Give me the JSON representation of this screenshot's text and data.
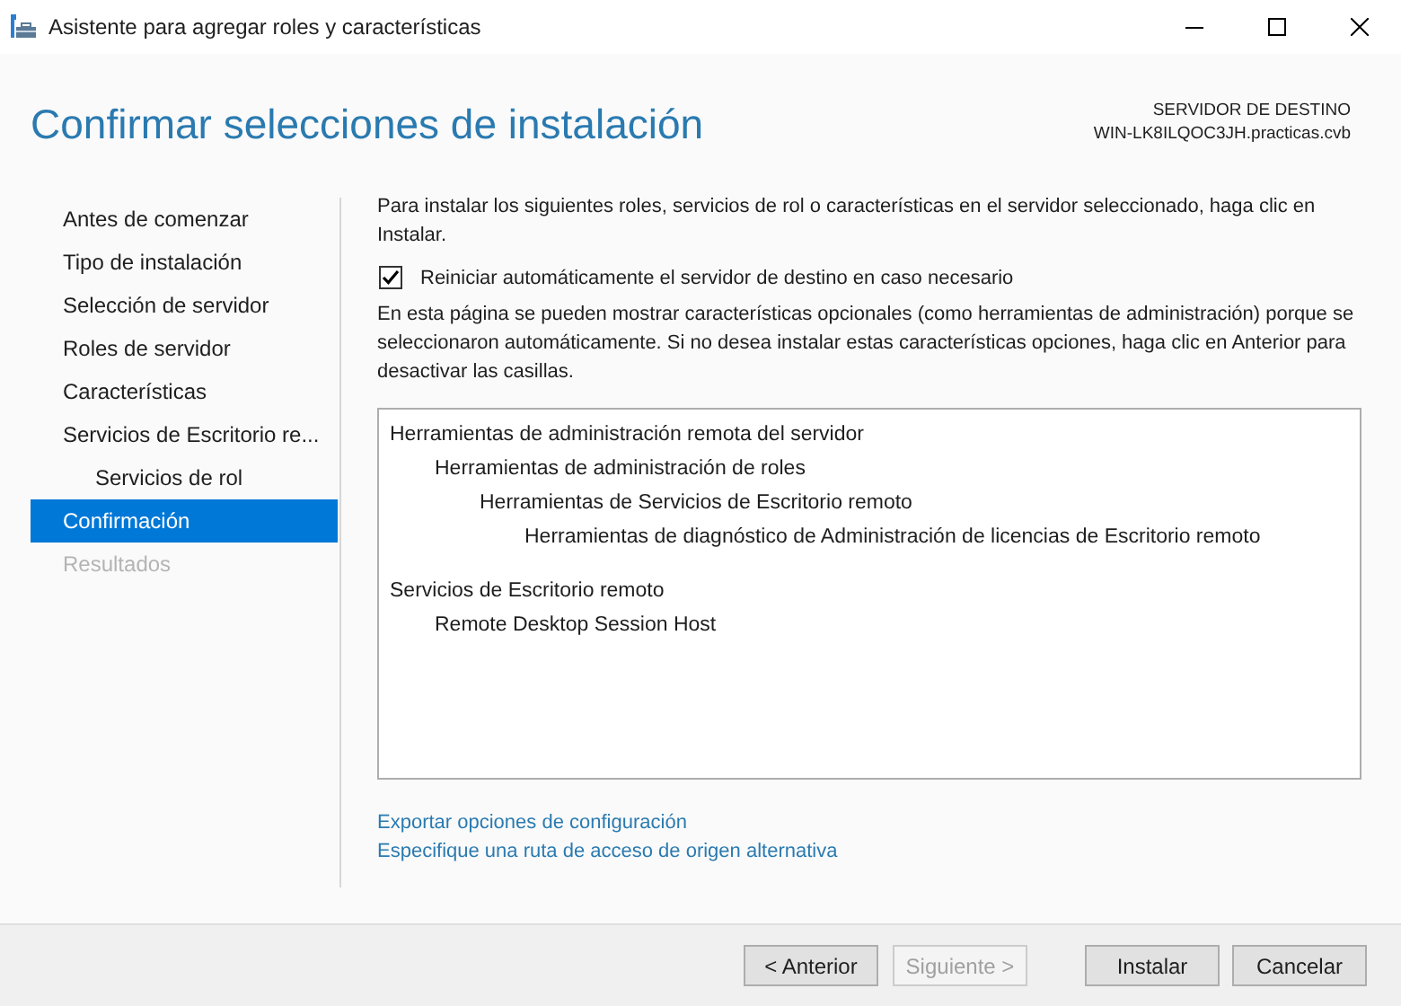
{
  "window": {
    "title": "Asistente para agregar roles y características"
  },
  "page_title": "Confirmar selecciones de instalación",
  "destination": {
    "label": "SERVIDOR DE DESTINO",
    "server": "WIN-LK8ILQOC3JH.practicas.cvb"
  },
  "sidebar": {
    "items": [
      {
        "label": "Antes de comenzar",
        "selected": false,
        "disabled": false
      },
      {
        "label": "Tipo de instalación",
        "selected": false,
        "disabled": false
      },
      {
        "label": "Selección de servidor",
        "selected": false,
        "disabled": false
      },
      {
        "label": "Roles de servidor",
        "selected": false,
        "disabled": false
      },
      {
        "label": "Características",
        "selected": false,
        "disabled": false
      },
      {
        "label": "Servicios de Escritorio re...",
        "selected": false,
        "disabled": false,
        "children": [
          {
            "label": "Servicios de rol",
            "selected": false,
            "disabled": false
          }
        ]
      },
      {
        "label": "Confirmación",
        "selected": true,
        "disabled": false
      },
      {
        "label": "Resultados",
        "selected": false,
        "disabled": true
      }
    ]
  },
  "intro": "Para instalar los siguientes roles, servicios de rol o características en el servidor seleccionado, haga clic en Instalar.",
  "restart_checkbox": {
    "label": "Reiniciar automáticamente el servidor de destino en caso necesario",
    "checked": true
  },
  "note": "En esta página se pueden mostrar características opcionales (como herramientas de administración) porque se seleccionaron automáticamente. Si no desea instalar estas características opciones, haga clic en Anterior para desactivar las casillas.",
  "selections": [
    {
      "label": "Herramientas de administración remota del servidor",
      "children": [
        {
          "label": "Herramientas de administración de roles",
          "children": [
            {
              "label": "Herramientas de Servicios de Escritorio remoto",
              "children": [
                {
                  "label": "Herramientas de diagnóstico de Administración de licencias de Escritorio remoto"
                }
              ]
            }
          ]
        }
      ]
    },
    {
      "label": "Servicios de Escritorio remoto",
      "children": [
        {
          "label": "Remote Desktop Session Host"
        }
      ]
    }
  ],
  "links": [
    "Exportar opciones de configuración",
    "Especifique una ruta de acceso de origen alternativa"
  ],
  "buttons": [
    {
      "label": "< Anterior",
      "disabled": false
    },
    {
      "label": "Siguiente >",
      "disabled": true
    },
    {
      "label": "Instalar",
      "disabled": false
    },
    {
      "label": "Cancelar",
      "disabled": false
    }
  ]
}
